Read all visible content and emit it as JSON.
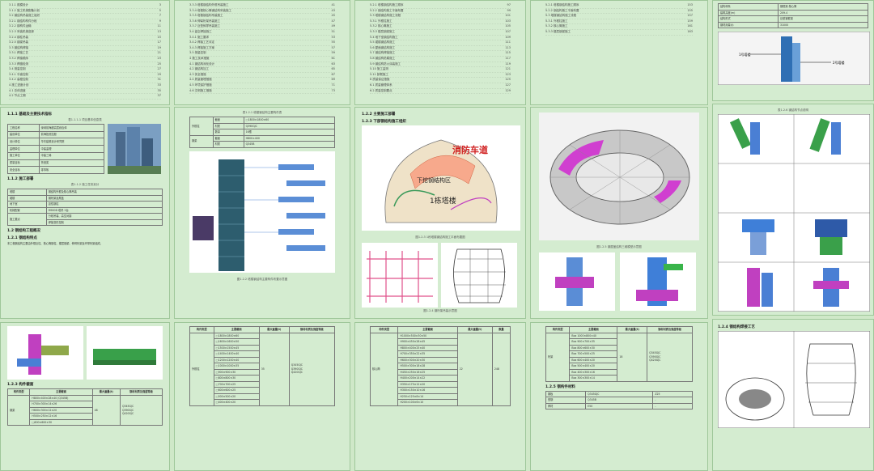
{
  "pages": {
    "p1_toc": [
      "3.1.1 爬模设计",
      "3.1.2 施工机械配备计划",
      "3.2 钢结构吊装施工组织",
      "3.2.1 钢结构构件分段",
      "3.2.2 钢构件运输",
      "3.2.3 吊装机械选择",
      "3.2.4 钢柱吊装",
      "3.2.5 钢梁吊装",
      "3.3 钢结构焊接",
      "3.3.1 焊接工艺",
      "3.3.2 焊接顺序",
      "3.3.3 焊缝检测",
      "3.4 测量控制",
      "3.4.1 平面控制",
      "3.4.2 高程控制",
      "4 施工进度计划",
      "4.1 总体进度",
      "4.2 节点工期"
    ],
    "p1_heading1": "1.1.1 基础及主要技术指标",
    "p1_caption1": "表1.1.1-1 项目基本信息表",
    "p1_heading2": "1.1.2 施工部署",
    "p1_caption2": "表1.1.2 施工任务划分",
    "p1_heading3": "1.2 钢结构工程概况",
    "p1_heading4": "1.2.1 钢结构特点",
    "p2_toc": [
      "3.3.3 塔楼钢结构外框吊装施工",
      "3.3.4 塔楼核心筒钢结构吊装施工",
      "3.3.5 塔楼钢结构吊装施工",
      "3.3.6 伸臂桁架吊装施工",
      "3.3.7 巨型斜撑吊装施工",
      "3.4 高空焊接施工",
      "3.4.1 施工要求",
      "3.4.2 焊接工艺评定",
      "3.4.3 焊接施工方案",
      "3.5 测量控制",
      "4 施工技术措施",
      "4.1 钢结构深化设计",
      "4.2 钢结构加工",
      "4.3 安全措施",
      "4.4 质量管理措施",
      "4.5 环境保护措施",
      "4.6 文明施工措施"
    ],
    "p2_caption": "表1.2.1 塔楼钢结构主要构件表",
    "p2_fig_caption": "图1.2.2 塔楼钢结构主要构件布置示意图",
    "p3_toc": [
      "5.2.1 塔楼钢结构施工顺序",
      "5.2.2 钢结构施工平面布置",
      "5.3 塔楼钢结构施工流程",
      "5.3.1 外框柱施工",
      "5.3.2 核心筒施工",
      "5.3.3 楼层钢梁施工",
      "5.4 地下室钢结构施工",
      "5.5 裙楼钢结构施工",
      "5.6 屋面钢结构施工",
      "5.7 钢结构焊接施工",
      "5.8 钢结构防腐施工",
      "5.9 钢结构防火涂装施工",
      "5.10 施工监测",
      "5.11 卸载施工",
      "6 质量保证措施",
      "6.1 质量管理体系",
      "6.2 质量控制要点"
    ],
    "p3_heading1": "1.2.2 主要施工部署",
    "p3_heading2": "1.2.3 下部钢结构施工组织",
    "p3_label_road": "消防车道",
    "p3_label_crane": "下挖钢结构区",
    "p3_label_tower": "1栋塔楼",
    "p3_fig_caption": "图1.2.3 1栋塔楼钢结构施工平面布置图",
    "p3_fig2_caption": "图1.2.4 钢桁架吊装示意图",
    "p4_fig_caption": "图1.2.5 钢屋盖结构三维模型示意图",
    "p5_caption": "表1.2.6 钢结构节点说明",
    "p5_label_a": "1号塔楼",
    "p5_label_b": "2号塔楼",
    "p6_heading": "1.2.4 钢结构焊接工艺",
    "p7_heading": "1.2.5 钢构件材料",
    "table_cols": [
      "构件类型",
      "主要截面",
      "最大重量(t)",
      "数量",
      "钢材材质及强度等级"
    ],
    "table_material": "Q345GJC\nQ390GJC\nQ420GJC",
    "row_item": "H800×400×28×40 (Q345B)"
  },
  "colors": {
    "page_bg": "#d4ecd0",
    "accent_magenta": "#d02fd0",
    "accent_blue": "#3a70d8",
    "accent_green": "#39b44a"
  }
}
